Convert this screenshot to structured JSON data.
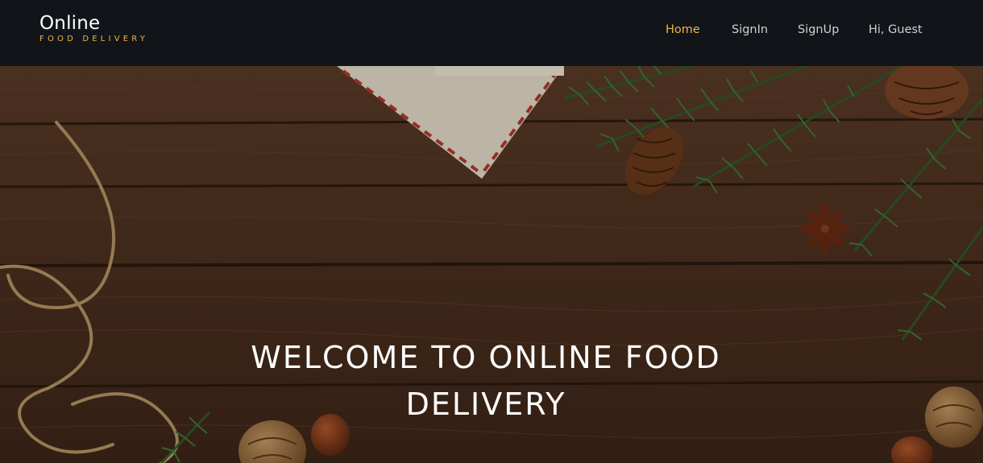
{
  "brand": {
    "name": "Online",
    "tagline": "FOOD DELIVERY"
  },
  "nav": {
    "items": [
      {
        "label": "Home",
        "active": true
      },
      {
        "label": "SignIn",
        "active": false
      },
      {
        "label": "SignUp",
        "active": false
      },
      {
        "label": "Hi, Guest",
        "active": false
      }
    ]
  },
  "hero": {
    "title": "WELCOME TO ONLINE FOOD DELIVERY"
  },
  "colors": {
    "navbar_bg": "#11151a",
    "accent": "#f0b24a",
    "nav_text": "#d0d0d0",
    "hero_text": "#ffffff"
  }
}
